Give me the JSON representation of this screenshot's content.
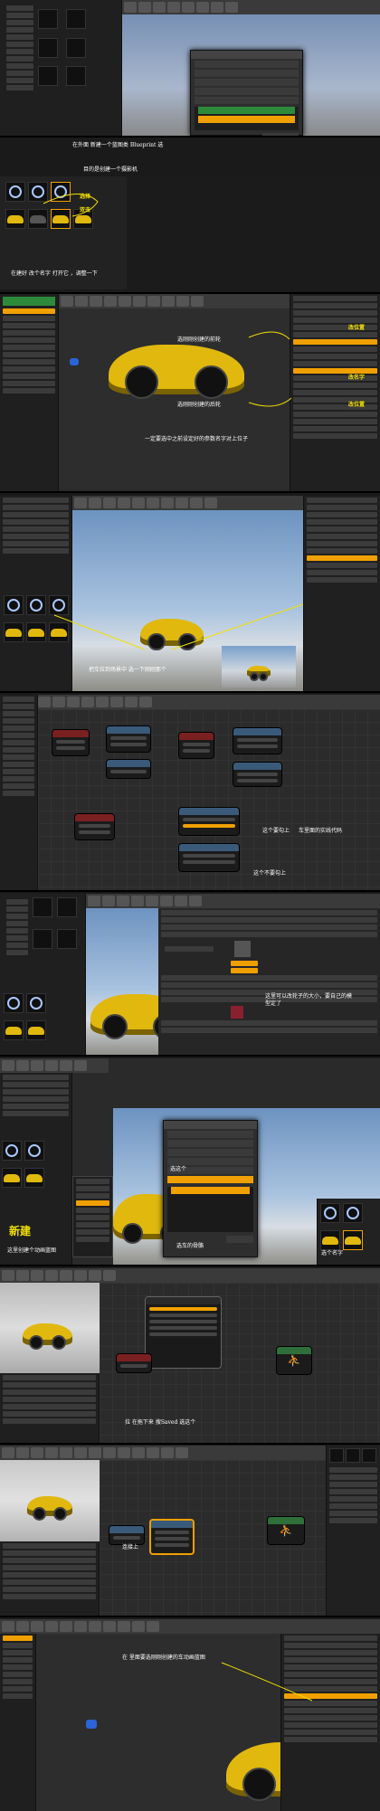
{
  "annotations": {
    "p1_main": "在外面  新建一个蓝图类  Blueprint  选",
    "p1_sub": "目的是创建一个摄影机",
    "p2_a": "选择",
    "p2_b": "双击",
    "p2_main": "在建好  改个名字  打开它 ，调整一下",
    "p3_top": "选刚刚创建的前轮",
    "p3_mid": "选刚刚创建的后轮",
    "p3_bottom": "一定要选中之前设定好的参数名字对上位子",
    "p3_r1": "改位置",
    "p3_r2": "改名字",
    "p3_r3": "改位置",
    "p4_main": "把车拉到场景中  选一下刚刚那个",
    "p5_a": "这个要勾上",
    "p5_b": "车里面的实线代码",
    "p5_c": "这个不要勾上",
    "p6_a": "这里可以改轮子的大小，要自己的模型定了",
    "p7_new": "新建",
    "p7_a": "这里创建个动画蓝图",
    "p7_b": "选这个",
    "p7_c": "选车的骨骼",
    "p7_d": "选个名字",
    "p8_a": "拉  在拖下来  搜Saved  选这个",
    "p9_a": "连接上",
    "p10_a": "在  里面要选刚刚创建的车动画蓝图"
  },
  "icons": {
    "toolbar": "toolbar-icon",
    "sphere_reflection": "sphere-reflection-icon",
    "car_asset": "car-asset-icon",
    "character_run": "character-run-icon",
    "camera": "camera-icon"
  },
  "colors": {
    "accent_orange": "#f0a000",
    "annotation_yellow": "#f1e000",
    "car_yellow": "#e0b80e",
    "editor_bg": "#2a2a2a"
  }
}
